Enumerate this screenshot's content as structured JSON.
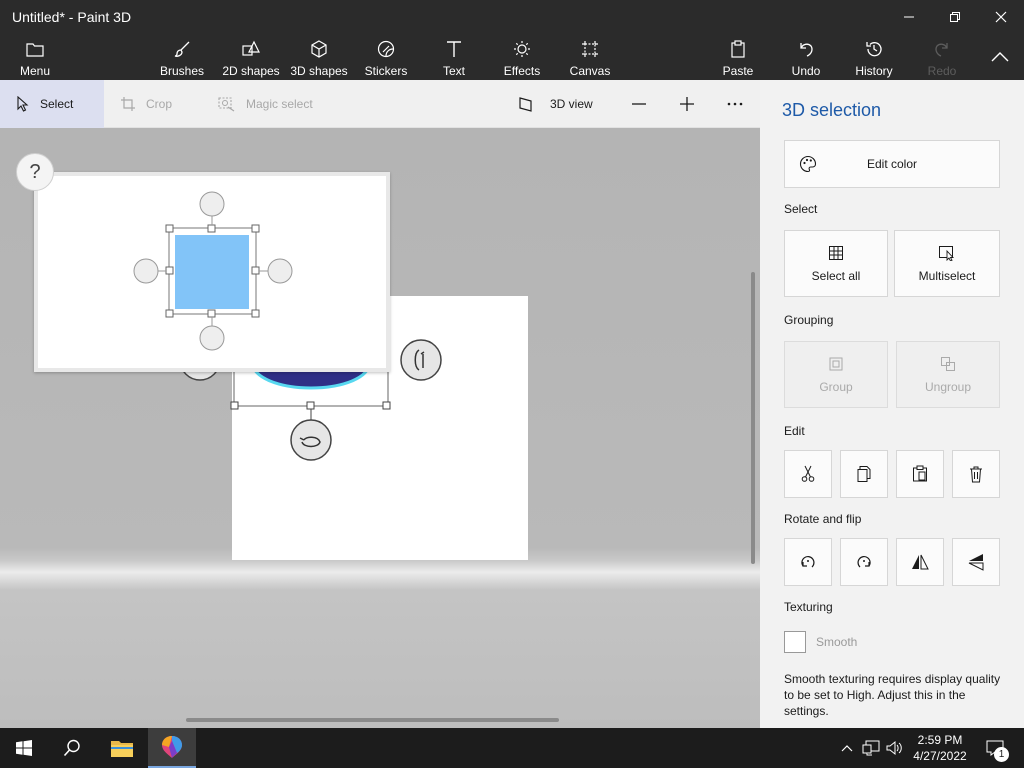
{
  "window": {
    "title": "Untitled* - Paint 3D"
  },
  "ribbon": {
    "menu": "Menu",
    "brushes": "Brushes",
    "shapes2d": "2D shapes",
    "shapes3d": "3D shapes",
    "stickers": "Stickers",
    "text": "Text",
    "effects": "Effects",
    "canvas": "Canvas",
    "paste": "Paste",
    "undo": "Undo",
    "history": "History",
    "redo": "Redo"
  },
  "toolbar": {
    "select": "Select",
    "crop": "Crop",
    "magic_select": "Magic select",
    "view3d": "3D view"
  },
  "help": {
    "label": "?"
  },
  "panel": {
    "title": "3D selection",
    "edit_color": "Edit color",
    "select_section": "Select",
    "select_all": "Select all",
    "multiselect": "Multiselect",
    "grouping_section": "Grouping",
    "group": "Group",
    "ungroup": "Ungroup",
    "edit_section": "Edit",
    "rotate_section": "Rotate and flip",
    "texturing_section": "Texturing",
    "smooth": "Smooth",
    "smooth_note": "Smooth texturing requires display quality to be set to High. Adjust this in the settings."
  },
  "taskbar": {
    "time": "2:59 PM",
    "date": "4/27/2022",
    "notifications": "1"
  },
  "colors": {
    "accent": "#1e5aa8",
    "shape_fill": "#82c4f8",
    "dark": "#2b2b2b"
  }
}
